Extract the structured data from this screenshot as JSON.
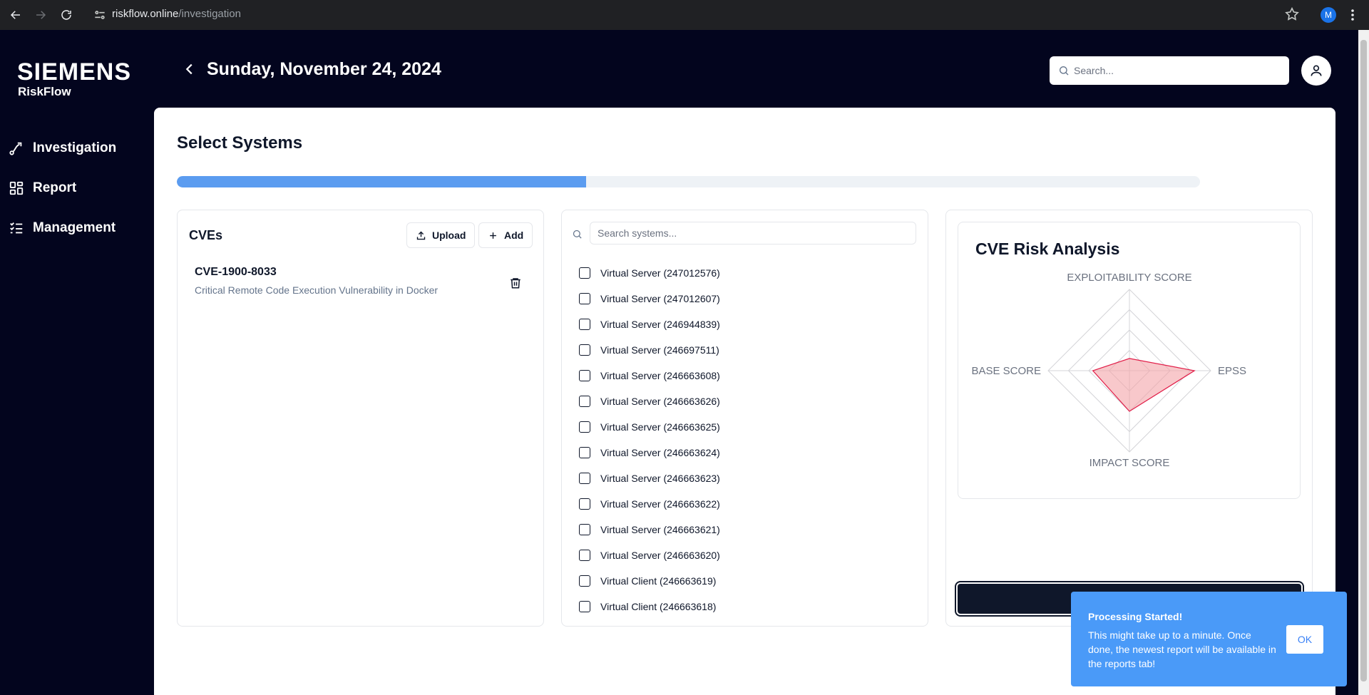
{
  "browser": {
    "url_host": "riskflow.online",
    "url_path": "/investigation",
    "profile_initial": "M"
  },
  "brand": {
    "logo": "SIEMENS",
    "product": "RiskFlow"
  },
  "sidebar": {
    "items": [
      {
        "label": "Investigation",
        "icon": "route-icon"
      },
      {
        "label": "Report",
        "icon": "grid-icon"
      },
      {
        "label": "Management",
        "icon": "list-checks-icon"
      }
    ]
  },
  "header": {
    "date": "Sunday, November 24, 2024",
    "search_placeholder": "Search..."
  },
  "main": {
    "title": "Select Systems",
    "progress": 0.4
  },
  "cves": {
    "title": "CVEs",
    "upload_label": "Upload",
    "add_label": "Add",
    "items": [
      {
        "id": "CVE-1900-8033",
        "description": "Critical Remote Code Execution Vulnerability in Docker"
      }
    ]
  },
  "systems": {
    "search_placeholder": "Search systems...",
    "items": [
      "Virtual Server (247012576)",
      "Virtual Server (247012607)",
      "Virtual Server (246944839)",
      "Virtual Server (246697511)",
      "Virtual Server (246663608)",
      "Virtual Server (246663626)",
      "Virtual Server (246663625)",
      "Virtual Server (246663624)",
      "Virtual Server (246663623)",
      "Virtual Server (246663622)",
      "Virtual Server (246663621)",
      "Virtual Server (246663620)",
      "Virtual Client (246663619)",
      "Virtual Client (246663618)"
    ]
  },
  "risk": {
    "title": "CVE Risk Analysis",
    "chart_data": {
      "type": "radar",
      "axes": [
        "EXPLOITABILITY SCORE",
        "EPSS",
        "IMPACT SCORE",
        "BASE SCORE"
      ],
      "values": [
        0.15,
        0.8,
        0.5,
        0.45
      ],
      "rings": 4,
      "fill_color": "#f4a3a8",
      "stroke_color": "#e11d48"
    }
  },
  "toast": {
    "title": "Processing Started!",
    "message": "This might take up to a minute. Once done, the newest report will be available in the reports tab!",
    "ok_label": "OK"
  }
}
